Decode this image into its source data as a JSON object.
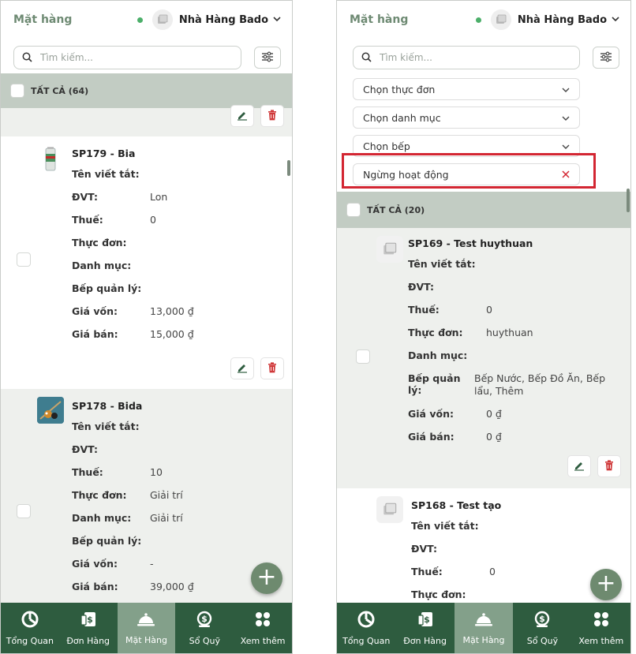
{
  "left": {
    "header": {
      "title": "Mặt hàng",
      "store": "Nhà Hàng Bado"
    },
    "search": {
      "placeholder": "Tìm kiếm..."
    },
    "all": {
      "label": "TẤT CẢ (64)"
    },
    "labels": {
      "short": "Tên viết tắt:",
      "unit": "ĐVT:",
      "tax": "Thuế:",
      "menu": "Thực đơn:",
      "category": "Danh mục:",
      "kitchen": "Bếp quản lý:",
      "cost": "Giá vốn:",
      "price": "Giá bán:"
    },
    "items": [
      {
        "code": "SP179 - Bia",
        "unit": "Lon",
        "tax": "0",
        "menu": "",
        "category": "",
        "kitchen": "",
        "cost": "13,000 ₫",
        "price": "15,000 ₫"
      },
      {
        "code": "SP178 - Bida",
        "unit": "",
        "tax": "10",
        "menu": "Giải trí",
        "category": "Giải trí",
        "kitchen": "",
        "cost": "-",
        "price": "39,000 ₫"
      }
    ]
  },
  "right": {
    "header": {
      "title": "Mặt hàng",
      "store": "Nhà Hàng Bado"
    },
    "search": {
      "placeholder": "Tìm kiếm..."
    },
    "filters": {
      "menu": "Chọn thực đơn",
      "category": "Chọn danh mục",
      "kitchen": "Chọn bếp",
      "status": "Ngừng hoạt động"
    },
    "all": {
      "label": "TẤT CẢ (20)"
    },
    "labels": {
      "short": "Tên viết tắt:",
      "unit": "ĐVT:",
      "tax": "Thuế:",
      "menu": "Thực đơn:",
      "category": "Danh mục:",
      "kitchen": "Bếp quản lý:",
      "cost": "Giá vốn:",
      "price": "Giá bán:"
    },
    "items": [
      {
        "code": "SP169 - Test huythuan",
        "unit": "",
        "tax": "0",
        "menu": "huythuan",
        "category": "",
        "kitchen": "Bếp Nước, Bếp Đồ Ăn, Bếp lẩu, Thêm",
        "cost": "0 ₫",
        "price": "0 ₫"
      },
      {
        "code": "SP168 - Test tạo",
        "unit": "",
        "tax": "0",
        "menu": ""
      }
    ]
  },
  "nav": [
    {
      "label": "Tổng Quan",
      "icon": "dashboard-icon"
    },
    {
      "label": "Đơn Hàng",
      "icon": "order-icon"
    },
    {
      "label": "Mặt Hàng",
      "icon": "cloche-icon",
      "active": true
    },
    {
      "label": "Sổ Quỹ",
      "icon": "money-bag-icon"
    },
    {
      "label": "Xem thêm",
      "icon": "grid-icon"
    }
  ],
  "colors": {
    "primary": "#2e5c3f",
    "active_tab": "#83a08a",
    "highlight": "#d32632",
    "delete": "#d0393a"
  }
}
